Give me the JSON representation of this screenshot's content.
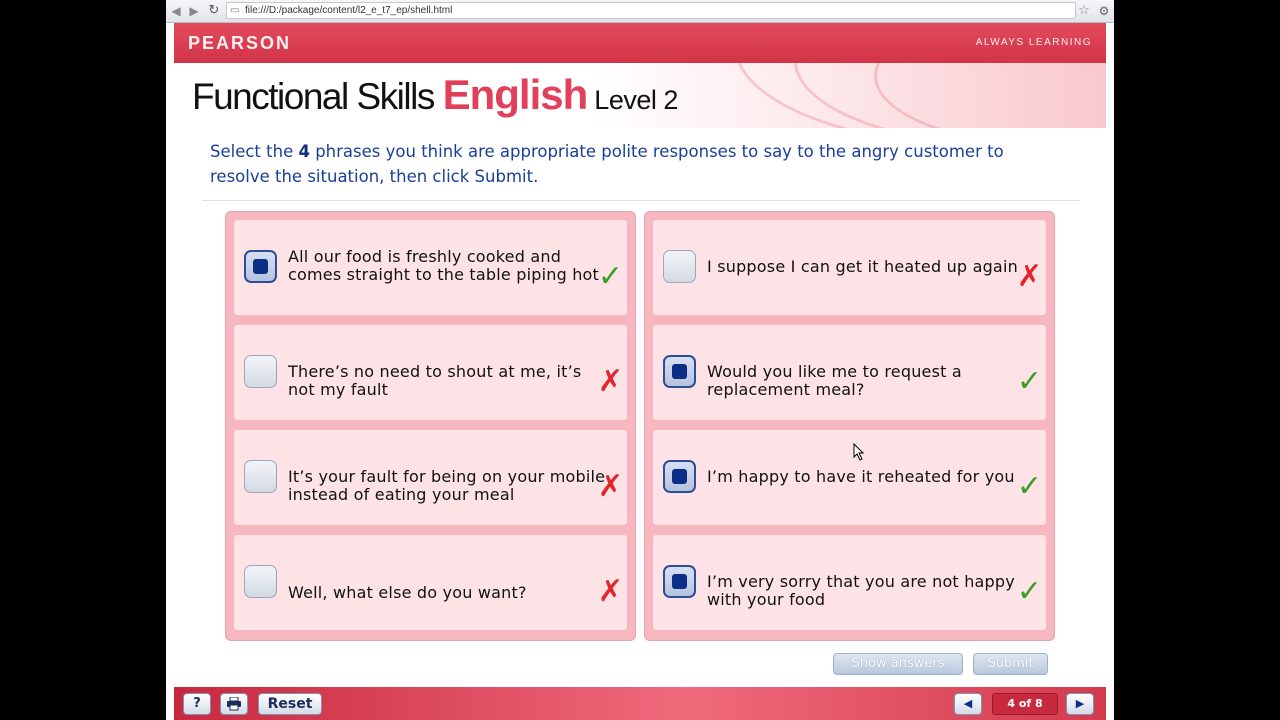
{
  "browser": {
    "url": "file:///D:/package/content/l2_e_t7_ep/shell.html",
    "icons": {
      "back": "back-arrow-icon",
      "forward": "forward-arrow-icon",
      "reload": "reload-icon",
      "page": "page-icon",
      "star": "star-icon",
      "wrench": "wrench-icon"
    }
  },
  "brand": {
    "logo": "PEARSON",
    "tagline": "ALWAYS LEARNING"
  },
  "title": {
    "part1": "Functional Skills ",
    "part2": "English",
    "part3": " Level 2"
  },
  "instructions": {
    "before": "Select the ",
    "number": "4",
    "after": " phrases you think are appropriate polite responses to say to the angry customer to resolve the situation, then click Submit."
  },
  "options_left": [
    {
      "text": "All our food is freshly cooked and comes straight to the table piping hot",
      "checked": true,
      "mark": "✓",
      "correct": true
    },
    {
      "text": "There’s no need to shout at me, it’s not my fault",
      "checked": false,
      "mark": "✗",
      "correct": false
    },
    {
      "text": "It’s your fault for being on your mobile instead of eating your meal",
      "checked": false,
      "mark": "✗",
      "correct": false
    },
    {
      "text": "Well, what else do you want?",
      "checked": false,
      "mark": "✗",
      "correct": false
    }
  ],
  "options_right": [
    {
      "text": "I suppose I can get it heated up again",
      "checked": false,
      "mark": "✗",
      "correct": false
    },
    {
      "text": "Would you like me to request a replacement meal?",
      "checked": true,
      "mark": "✓",
      "correct": true
    },
    {
      "text": "I’m happy to have it reheated for you",
      "checked": true,
      "mark": "✓",
      "correct": true
    },
    {
      "text": "I’m very sorry that you are not happy with your food",
      "checked": true,
      "mark": "✓",
      "correct": true
    }
  ],
  "buttons": {
    "show_answers": "Show answers",
    "submit": "Submit",
    "reset": "Reset",
    "help": "?",
    "prev": "◀",
    "next": "▶"
  },
  "pagination": {
    "label": "4 of 8"
  },
  "colors": {
    "brand_red": "#d23447",
    "title_red": "#e2405a",
    "instruction_blue": "#1a3f99",
    "tick_green": "#3a9e28",
    "cross_red": "#e3242b"
  }
}
